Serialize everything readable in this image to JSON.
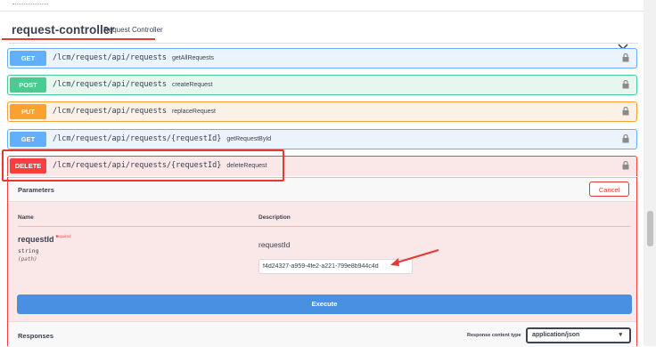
{
  "tag": {
    "name": "request-controller",
    "description": "Request Controller"
  },
  "operations": [
    {
      "method": "GET",
      "path": "/lcm/request/api/requests",
      "summary": "getAllRequests"
    },
    {
      "method": "POST",
      "path": "/lcm/request/api/requests",
      "summary": "createRequest"
    },
    {
      "method": "PUT",
      "path": "/lcm/request/api/requests",
      "summary": "replaceRequest"
    },
    {
      "method": "GET",
      "path": "/lcm/request/api/requests/{requestId}",
      "summary": "getRequestById"
    },
    {
      "method": "DELETE",
      "path": "/lcm/request/api/requests/{requestId}",
      "summary": "deleteRequest"
    }
  ],
  "parameters_panel": {
    "title": "Parameters",
    "cancel_label": "Cancel",
    "col_name": "Name",
    "col_description": "Description",
    "param": {
      "name": "requestId",
      "required_star": "*",
      "required_label": "required",
      "type": "string",
      "location": "(path)",
      "description": "requestId",
      "value": "f4d24327-a959-4fe2-a221-799e8b944c4d"
    },
    "execute_label": "Execute"
  },
  "responses": {
    "title": "Responses",
    "content_type_label": "Response content type",
    "content_type_value": "application/json"
  },
  "colors": {
    "get": "#61affe",
    "post": "#49cc90",
    "put": "#fca130",
    "delete": "#f93e3e",
    "execute": "#4990e2",
    "annotation": "#e53935"
  }
}
